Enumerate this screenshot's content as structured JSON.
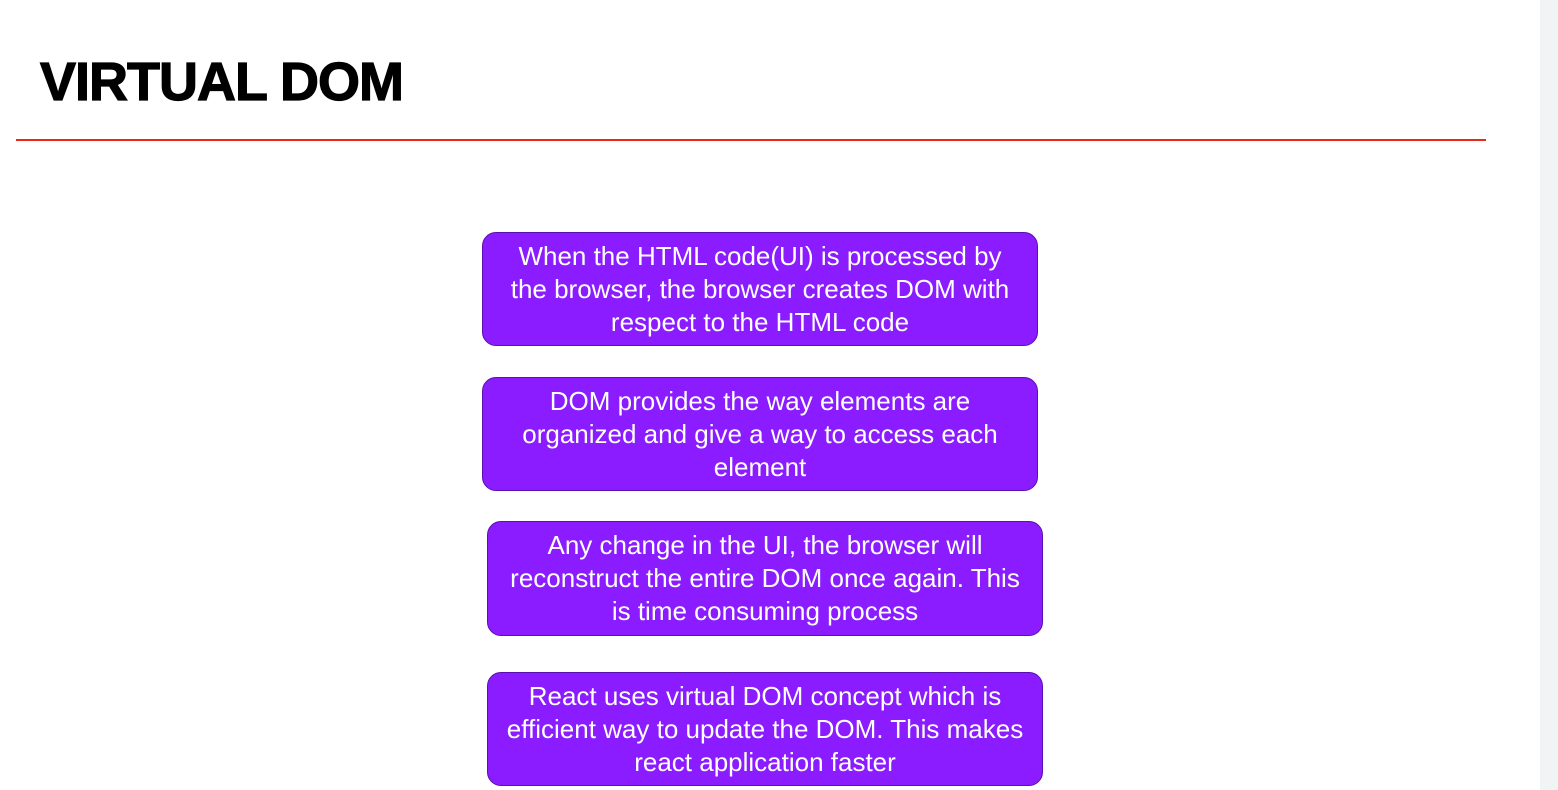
{
  "slide": {
    "title": "VIRTUAL DOM",
    "accent_color": "#e8291c",
    "box_color": "#8a1cff",
    "boxes": [
      {
        "text": "When the HTML code(UI) is processed by the browser, the browser creates DOM with respect to the HTML code"
      },
      {
        "text": "DOM provides the way elements are organized and give a way to access each element"
      },
      {
        "text": "Any change in the UI, the browser will reconstruct the entire DOM once again. This is time consuming process"
      },
      {
        "text": "React uses virtual DOM concept which is efficient way to update the DOM. This makes react application faster"
      }
    ]
  }
}
